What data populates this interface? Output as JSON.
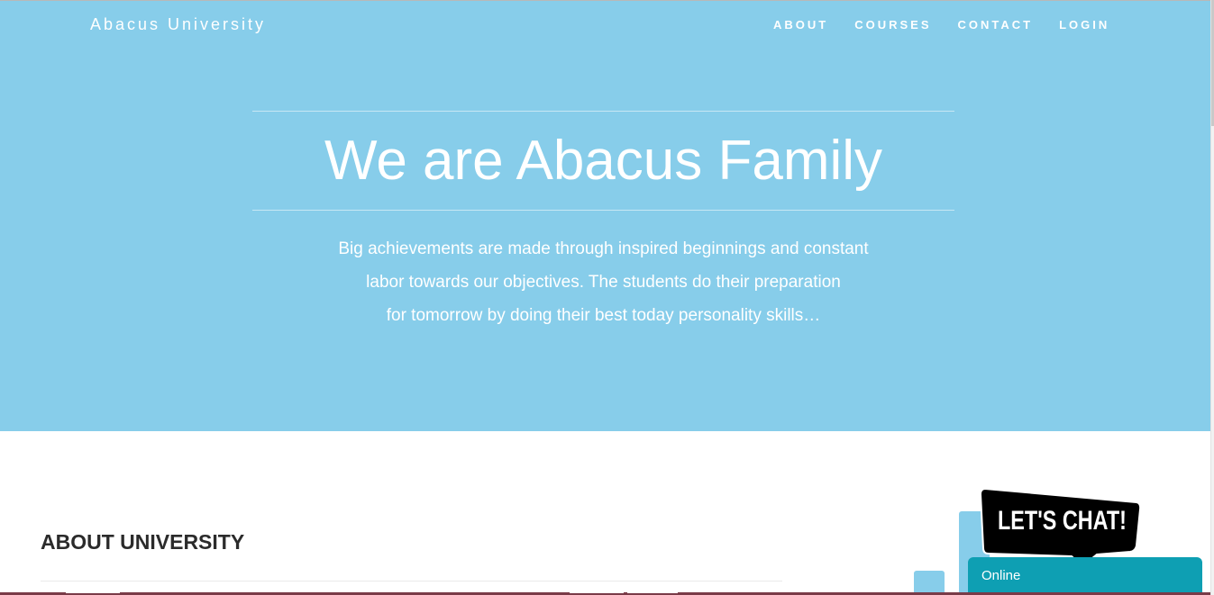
{
  "header": {
    "brand": "Abacus University",
    "nav": [
      {
        "label": "ABOUT"
      },
      {
        "label": "COURSES"
      },
      {
        "label": "CONTACT"
      },
      {
        "label": "LOGIN"
      }
    ]
  },
  "hero": {
    "title": "We are Abacus Family",
    "text_lines": [
      "Big achievements are made through inspired beginnings and constant",
      "labor towards our objectives. The students do their preparation",
      "for tomorrow by doing their best today personality skills…"
    ]
  },
  "about": {
    "heading": "ABOUT UNIVERSITY"
  },
  "chat": {
    "bubble_label": "LET'S CHAT!",
    "status": "Online"
  },
  "colors": {
    "hero_bg": "#87cdea",
    "chat_bar": "#0e9fb3",
    "bubble": "#000000",
    "bottom_strip": "#7a3b48"
  }
}
